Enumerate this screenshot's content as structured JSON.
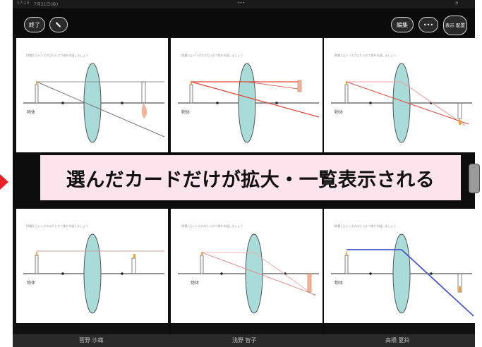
{
  "statusbar": {
    "time": "17:13",
    "date": "7月21日(金)",
    "dots": "•••"
  },
  "toolbar": {
    "end_label": "終了",
    "edit_label": "編集",
    "more_label": "•••",
    "display_label": "表示 配置"
  },
  "card_question": "[問題] 凸レンズのはたらきで像を作図しましょう",
  "object_label": "物体",
  "banner_text": "選んだカードだけが拡大・一覧表示される",
  "names": [
    "菅野 沙織",
    "浅野 智子",
    "高橋 夏鈴"
  ],
  "colors": {
    "banner_bg": "#fde3ec",
    "lens": "#a9dcd9",
    "ray_red": "#e0483a",
    "ray_gray": "#777777",
    "ray_blue": "#4a58c8",
    "arrow": "#e8202a"
  }
}
